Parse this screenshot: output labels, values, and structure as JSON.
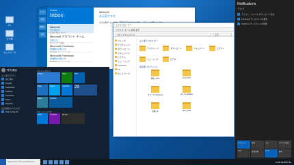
{
  "desktop": {
    "icons": [
      "PC",
      "ゴミ箱",
      "ネットワーク"
    ]
  },
  "mail": {
    "account": "Outlook",
    "title": "Inbox",
    "rail": [
      "メール",
      "予定",
      "連絡先",
      "設定"
    ],
    "list": [
      {
        "from": "takeuchi",
        "subject": "打ち合わせ",
        "preview": "来週の予定について"
      },
      {
        "from": "Microsoft アカウント チーム",
        "subject": "お知らせ",
        "preview": "セキュリティ情報"
      },
      {
        "from": "Microsoft Feedback",
        "subject": "新機能のお知らせ",
        "preview": "Windows フィードバック"
      },
      {
        "from": "Microsoft Feedback",
        "subject": "新機能のお知らせ",
        "preview": "Windows フィードバック"
      }
    ],
    "reading": {
      "from": "takeuchi",
      "subject": "お元気ですか",
      "body": "今日は晴れています。来週の打ち合わせの件、よろしくお願いします。"
    }
  },
  "explorer": {
    "title": "エクスプローラー",
    "ribbon": "ファイル  ホーム  共有  表示",
    "address": "PC > ドキュメント",
    "search": "検索",
    "nav": [
      "クイック",
      "デスクトップ",
      "ダウンロード",
      "ドキュメント",
      "ピクチャ",
      "ミュージック",
      "OneDrive",
      "PC",
      "ネットワーク"
    ],
    "section_frequent": "よく使うフォルダー",
    "section_recent": "最近使ったファイル",
    "folders": [
      "デスクトップ",
      "ダウンロード",
      "ドキュメント",
      "ピクチャ",
      "ミュージック",
      "ビデオ"
    ],
    "files": [
      "資料_2015",
      "screenshot",
      "スナップ_Windows",
      "pic_ch_desktop",
      "画像_01",
      "IMG_2015"
    ]
  },
  "action_center": {
    "title": "Notifications",
    "app": "フォト",
    "notes": [
      "アイコン：ファイル ダウンロード済み",
      "Facebook ディスプレイの更新",
      "OneDrive ディスプレイの同期"
    ],
    "quick": [
      "タブレット",
      "接続",
      "メモ",
      "すべての設定",
      "VPN",
      "位置情報",
      "Wi-Fi",
      "集中",
      "機内"
    ]
  },
  "start": {
    "user": "竹内 健太",
    "most_used_label": "よく使うアプリ",
    "apps": [
      "はじめに",
      "People",
      "Calculator",
      "Outlook",
      "OneDrive",
      "Maps",
      "Weather"
    ],
    "recent_label": "最近追加されたもの",
    "recent": [
      "Snip & Sketch"
    ],
    "tiles_label": "Life at a glance",
    "play_label": "Play and explore",
    "tiles": [
      {
        "name": "Photos",
        "color": "#2b7cd3"
      },
      {
        "name": "Xbox",
        "color": "#107c10"
      },
      {
        "name": "Mail",
        "color": "#0063b1"
      },
      {
        "name": "Edge",
        "color": "#1e6fc0"
      },
      {
        "name": "Skype",
        "color": "#00a2ed"
      },
      {
        "name": "Calendar",
        "color": "#0078d7"
      },
      {
        "name": "29",
        "color": "#1e4f8a"
      },
      {
        "name": "Maps",
        "color": "#2d7d9a"
      },
      {
        "name": "Weather",
        "color": "#0a5a9c"
      },
      {
        "name": "Store",
        "color": "#0078d7"
      },
      {
        "name": "OneNote",
        "color": "#7719aa"
      },
      {
        "name": "Movies",
        "color": "#2d2d2d"
      }
    ],
    "search_placeholder": "Search the web and Windows"
  },
  "taskbar": {
    "search": "Search the web and Windows",
    "time": "10:30",
    "date": "2015/07/29"
  }
}
